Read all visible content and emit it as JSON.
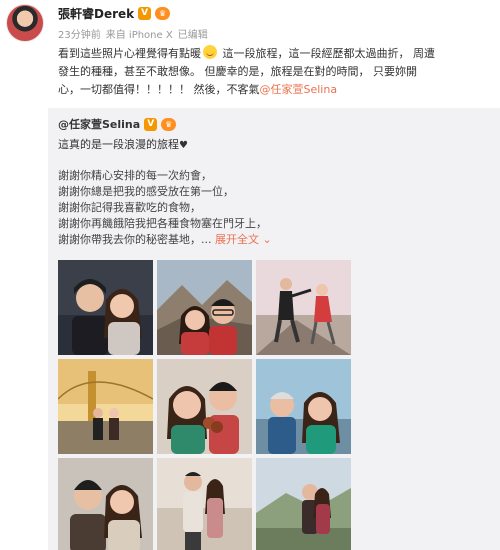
{
  "post": {
    "author": "張軒睿Derek",
    "verified_badge": "V",
    "vip_badge": "♛",
    "meta": {
      "time": "23分钟前",
      "source": "来自 iPhone X",
      "edited": "已编辑"
    },
    "text": {
      "line1_a": "看到這些照片心裡覺得有點暖",
      "line1_b": "這一段旅程，這一段經歷都太過曲折，",
      "line1_c": "周遭",
      "line2": "發生的種種，甚至不敢想像。",
      "line2_b": "但慶幸的是，旅程是在對的時間，",
      "line2_c": "只要妳開",
      "line3": "心，一切都值得！！！！！",
      "line3_b": "然後，不客氣",
      "mention": "@任家萱Selina"
    }
  },
  "repost": {
    "author": "@任家萱Selina",
    "verified_badge": "V",
    "vip_badge": "♛",
    "line1": "這真的是一段浪漫的旅程",
    "heart": "♥",
    "lines": [
      "謝謝你精心安排的每一次約會，",
      "謝謝你總是把我的感受放在第一位，",
      "謝謝你記得我喜歡吃的食物，",
      "謝謝你再饑餓陪我把各種食物塞在門牙上，",
      "謝謝你帶我去你的秘密基地，..."
    ],
    "expand_label": "展开全文",
    "expand_icon": "chevron-down-icon",
    "photos": [
      "photo-couple-selfie-night",
      "photo-couple-selfie-mountain",
      "photo-couple-dancing-outdoors",
      "photo-couple-bridge",
      "photo-couple-food",
      "photo-couple-selfie-boat",
      "photo-couple-selfie-jackets",
      "photo-couple-posing",
      "photo-couple-valley"
    ]
  }
}
